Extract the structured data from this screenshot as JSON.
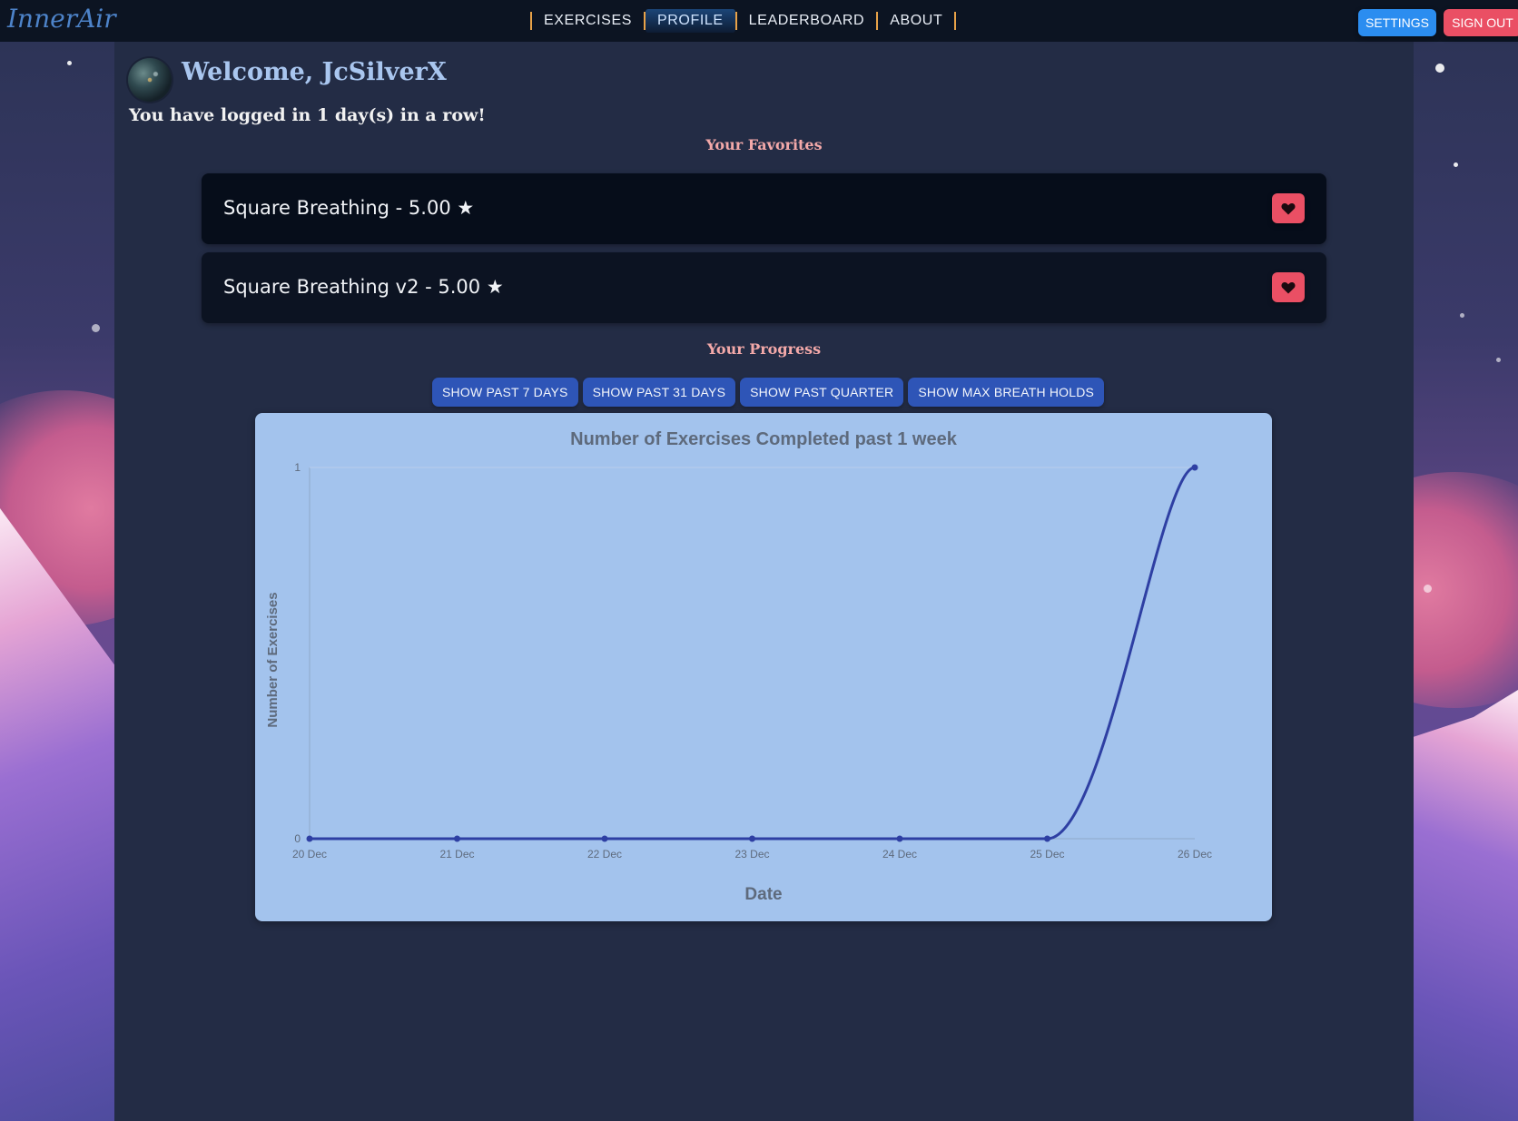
{
  "brand": {
    "logo_text": "InnerAir"
  },
  "nav": {
    "links": [
      {
        "label": "EXERCISES",
        "active": false
      },
      {
        "label": "PROFILE",
        "active": true
      },
      {
        "label": "LEADERBOARD",
        "active": false
      },
      {
        "label": "ABOUT",
        "active": false
      }
    ],
    "settings_label": "SETTINGS",
    "signout_label": "SIGN OUT"
  },
  "profile": {
    "welcome": "Welcome, JcSilverX",
    "streak": "You have logged in 1 day(s) in a row!"
  },
  "favorites": {
    "title": "Your Favorites",
    "items": [
      {
        "label": "Square Breathing - 5.00 ★"
      },
      {
        "label": "Square Breathing v2 - 5.00 ★"
      }
    ]
  },
  "progress": {
    "title": "Your Progress",
    "range_buttons": [
      "SHOW PAST 7 DAYS",
      "SHOW PAST 31 DAYS",
      "SHOW PAST QUARTER",
      "SHOW MAX BREATH HOLDS"
    ]
  },
  "colors": {
    "accent_blue": "#2b8df0",
    "accent_red": "#ea4f64",
    "nav_separator": "#e8a248",
    "line": "#2e3fa3",
    "chart_bg": "#a3c3ed"
  },
  "chart_data": {
    "type": "line",
    "title": "Number of Exercises Completed past 1 week",
    "xlabel": "Date",
    "ylabel": "Number of Exercises",
    "categories": [
      "20 Dec",
      "21 Dec",
      "22 Dec",
      "23 Dec",
      "24 Dec",
      "25 Dec",
      "26 Dec"
    ],
    "series": [
      {
        "values": [
          0,
          0,
          0,
          0,
          0,
          0,
          1
        ]
      }
    ],
    "ylim": [
      0,
      1
    ],
    "yticks": [
      0,
      1
    ],
    "grid": false,
    "legend": "none"
  }
}
